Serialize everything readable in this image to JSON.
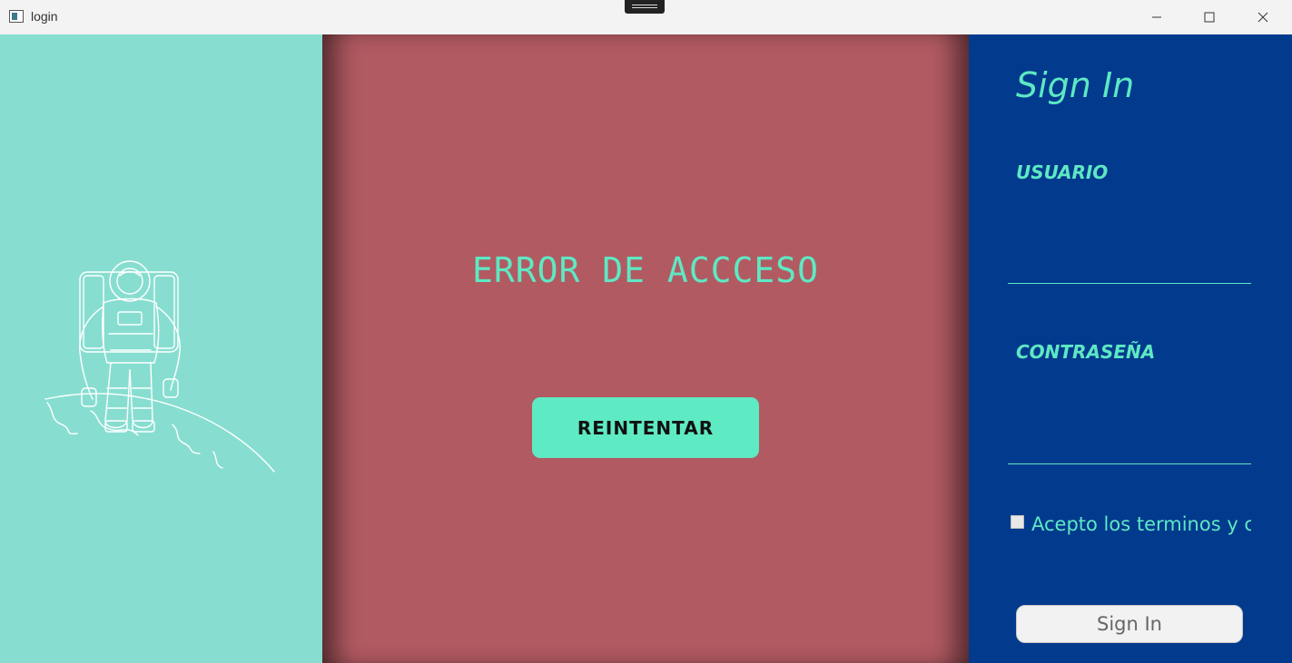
{
  "window": {
    "title": "login",
    "controls": {
      "minimize": "─",
      "maximize": "☐",
      "close": "✕"
    }
  },
  "left_panel": {
    "background": "#87ded0",
    "illustration": "astronaut-on-planet-icon"
  },
  "middle_panel": {
    "background": "#b15a62",
    "error_title": "ERROR DE ACCCESO",
    "retry_label": "REINTENTAR"
  },
  "right_panel": {
    "background": "#023a8e",
    "title": "Sign In",
    "username_label": "USUARIO",
    "username_value": "",
    "password_label": "CONTRASEÑA",
    "password_value": "",
    "terms_label": "Acepto los terminos y c",
    "terms_checked": false,
    "signin_label": "Sign In"
  },
  "colors": {
    "accent": "#5ee8c3",
    "button_bg": "#5eeac3"
  }
}
